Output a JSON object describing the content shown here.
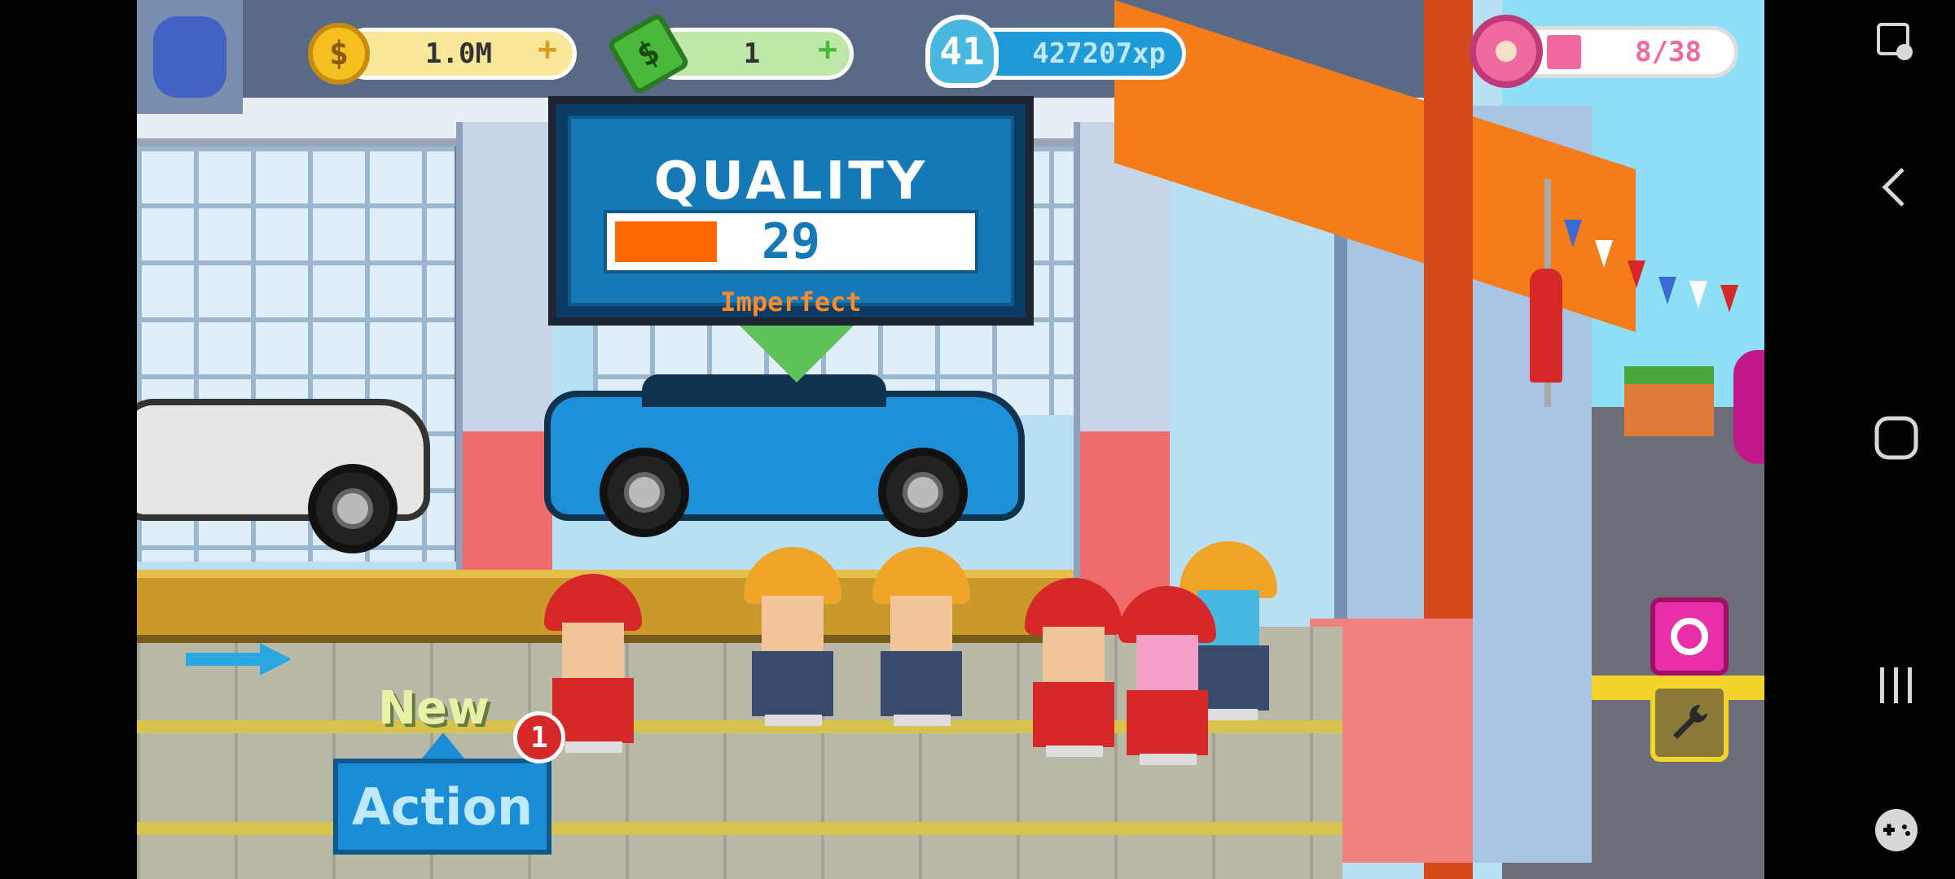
{
  "hud": {
    "money": "1.0M",
    "cash": "1",
    "level": "41",
    "xp": "427207xp",
    "donut_progress": "8/38",
    "money_icon": "dollar-coin-icon",
    "cash_icon": "cash-bill-icon",
    "xp_icon": "level-shield-icon",
    "donut_icon": "donut-icon"
  },
  "quality_panel": {
    "title": "QUALITY",
    "value": "29",
    "level": 0.29,
    "rating": "Imperfect",
    "bar_color": "#ff6a00"
  },
  "action": {
    "new_label": "New",
    "button_label": "Action",
    "badge_count": "1"
  },
  "side_buttons": [
    "photo-icon",
    "wrench-icon"
  ],
  "system_nav": [
    "screenshot-edit-icon",
    "back-icon",
    "home-icon",
    "recent-apps-icon",
    "game-controller-icon"
  ],
  "colors": {
    "money_pill": "#f9e79a",
    "cash_pill": "#bfe8a8",
    "xp_pill": "#1e9ad8",
    "donut_pill": "#ffffff",
    "action_button": "#1a8dd6",
    "car_blue": "#1e90d8",
    "car_white": "#e6e6e6"
  }
}
